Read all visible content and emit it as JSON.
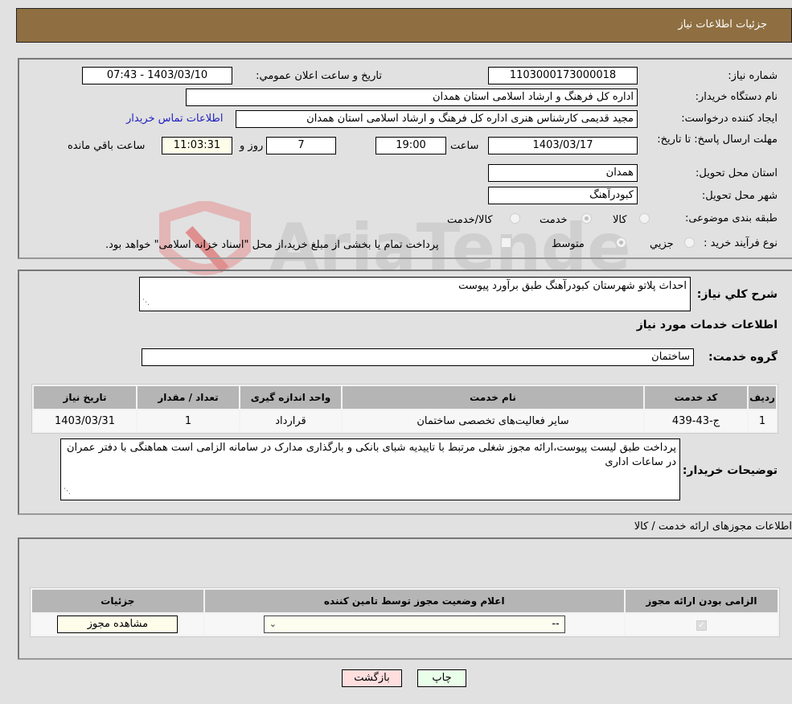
{
  "header": {
    "title": "جزئیات اطلاعات نیاز"
  },
  "need_number": {
    "label": "شماره نیاز:",
    "value": "1103000173000018"
  },
  "announce_datetime": {
    "label": "تاريخ و ساعت اعلان عمومي:",
    "value": "1403/03/10 - 07:43"
  },
  "buyer_org": {
    "label": "نام دستگاه خریدار:",
    "value": "اداره کل فرهنگ و ارشاد اسلامی استان همدان"
  },
  "requester": {
    "label": "ایجاد کننده درخواست:",
    "value": "مجید قدیمی کارشناس هنری اداره کل فرهنگ و ارشاد اسلامی استان همدان",
    "contact_link": "اطلاعات تماس خریدار"
  },
  "deadline": {
    "label": "مهلت ارسال پاسخ: تا تاریخ:",
    "date": "1403/03/17",
    "time_label": "ساعت",
    "time": "19:00",
    "days": "7",
    "days_label": "روز و",
    "remaining": "11:03:31",
    "remaining_label": "ساعت باقي مانده"
  },
  "province": {
    "label": "استان محل تحویل:",
    "value": "همدان"
  },
  "city": {
    "label": "شهر محل تحویل:",
    "value": "کبودرآهنگ"
  },
  "category": {
    "label": "طبقه بندی موضوعی:",
    "options": [
      "کالا",
      "خدمت",
      "کالا/خدمت"
    ],
    "selected": "خدمت"
  },
  "purchase_type": {
    "label": "نوع فرآیند خرید :",
    "options": [
      "جزيي",
      "متوسط"
    ],
    "selected": "متوسط",
    "treasury_note": "پرداخت تمام یا بخشی از مبلغ خرید،از محل \"اسناد خزانه اسلامی\" خواهد بود."
  },
  "summary": {
    "label": "شرح کلي نياز:",
    "value": "احداث پلاتو شهرستان کبودرآهنگ طبق برآورد پیوست"
  },
  "services_section": {
    "title": "اطلاعات خدمات مورد نیاز"
  },
  "service_group": {
    "label": "گروه خدمت:",
    "value": "ساختمان"
  },
  "services_table": {
    "headers": [
      "ردیف",
      "کد خدمت",
      "نام خدمت",
      "واحد اندازه گیری",
      "تعداد / مقدار",
      "تاریخ نیاز"
    ],
    "rows": [
      [
        "1",
        "ج-43-439",
        "سایر فعالیت‌های تخصصی ساختمان",
        "قرارداد",
        "1",
        "1403/03/31"
      ]
    ]
  },
  "buyer_notes": {
    "label": "توضیحات خریدار:",
    "value": "پرداخت طبق لیست پیوست،ارائه مجوز شغلی مرتبط با تاییدیه شبای بانکی و بارگذاری مدارک در سامانه الزامی است هماهنگی با دفتر عمران در ساعات اداری"
  },
  "license_section": {
    "title": "اطلاعات مجوزهای ارائه خدمت / کالا",
    "headers": [
      "الزامی بودن ارائه مجوز",
      "اعلام وضعیت مجوز توسط تامین کننده",
      "جزئیات"
    ],
    "row": {
      "required_checked": true,
      "status_value": "--",
      "view_button": "مشاهده مجوز"
    }
  },
  "buttons": {
    "print": "چاپ",
    "back": "بازگشت"
  },
  "colors": {
    "header_bg": "#8f6f42",
    "back_btn": "#ffdede",
    "print_btn": "#eaffea"
  }
}
